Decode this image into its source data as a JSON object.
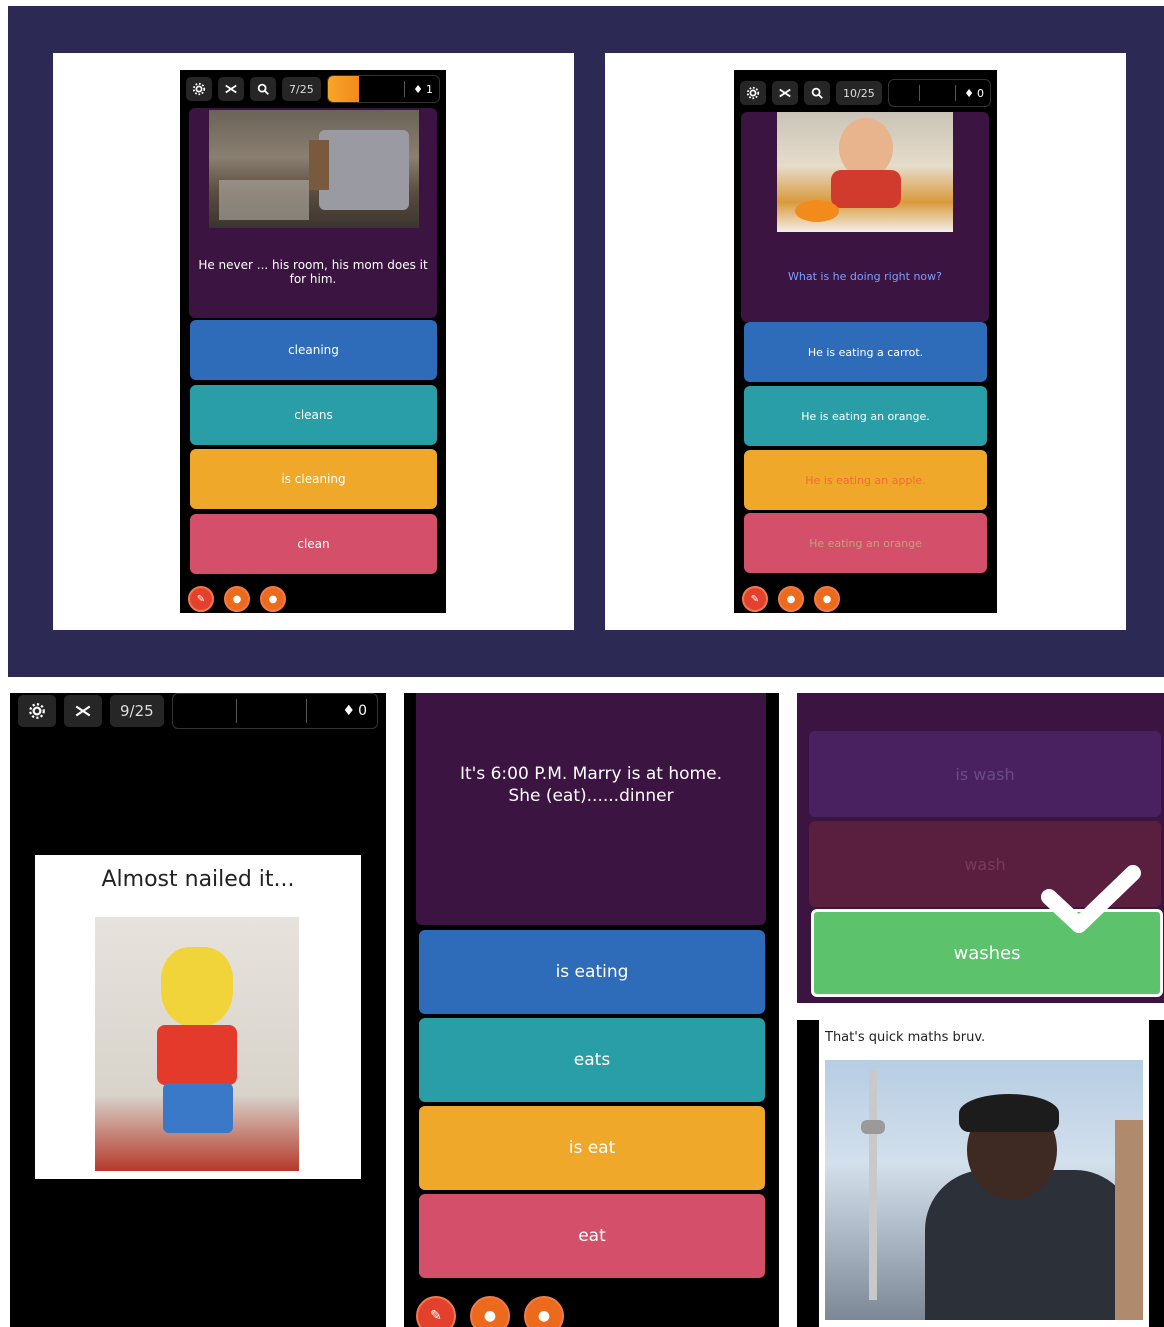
{
  "panels": {
    "top_left": {
      "counter": "7/25",
      "progress": 0.28,
      "streak": "1",
      "question": "He never ... his room, his mom does it for him.",
      "options": [
        "cleaning",
        "cleans",
        "is cleaning",
        "clean"
      ]
    },
    "top_right": {
      "counter": "10/25",
      "progress": 0,
      "streak": "0",
      "question": "What is he doing right now?",
      "options": [
        "He is eating a carrot.",
        "He is eating an orange.",
        "He is eating an apple.",
        "He eating an orange"
      ]
    },
    "bottom_left": {
      "counter": "9/25",
      "progress": 0,
      "streak": "0",
      "caption": "Almost nailed it..."
    },
    "bottom_middle": {
      "question": "It's 6:00 P.M. Marry is at home. She (eat)......dinner",
      "options": [
        "is eating",
        "eats",
        "is eat",
        "eat"
      ]
    },
    "bottom_right_top": {
      "faded_options": [
        "is wash",
        "wash"
      ],
      "correct_option": "washes"
    },
    "bottom_right_bottom": {
      "caption": "That's quick maths bruv."
    }
  },
  "colors": {
    "band": "#2c2a55",
    "question_bg": "#3b1442",
    "blue": "#2e6bb8",
    "teal": "#2a9ea7",
    "yellow": "#efa829",
    "red": "#d4506a",
    "green": "#5cc26b"
  },
  "icons": [
    "gear-icon",
    "shuffle-icon",
    "zoom-icon",
    "flame-icon",
    "eraser-icon",
    "fire-powerup-icon"
  ]
}
